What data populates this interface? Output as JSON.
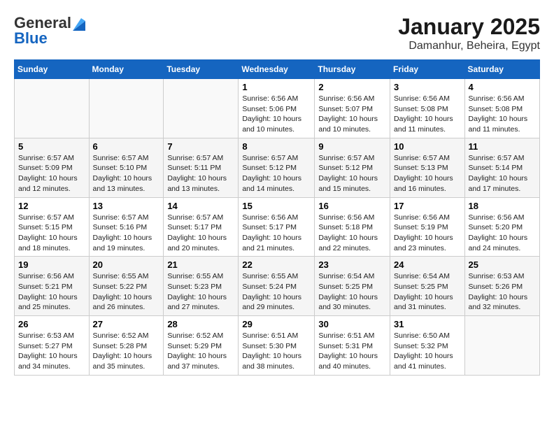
{
  "logo": {
    "general": "General",
    "blue": "Blue"
  },
  "title": {
    "month": "January 2025",
    "location": "Damanhur, Beheira, Egypt"
  },
  "weekdays": [
    "Sunday",
    "Monday",
    "Tuesday",
    "Wednesday",
    "Thursday",
    "Friday",
    "Saturday"
  ],
  "weeks": [
    [
      {
        "day": "",
        "info": ""
      },
      {
        "day": "",
        "info": ""
      },
      {
        "day": "",
        "info": ""
      },
      {
        "day": "1",
        "info": "Sunrise: 6:56 AM\nSunset: 5:06 PM\nDaylight: 10 hours\nand 10 minutes."
      },
      {
        "day": "2",
        "info": "Sunrise: 6:56 AM\nSunset: 5:07 PM\nDaylight: 10 hours\nand 10 minutes."
      },
      {
        "day": "3",
        "info": "Sunrise: 6:56 AM\nSunset: 5:08 PM\nDaylight: 10 hours\nand 11 minutes."
      },
      {
        "day": "4",
        "info": "Sunrise: 6:56 AM\nSunset: 5:08 PM\nDaylight: 10 hours\nand 11 minutes."
      }
    ],
    [
      {
        "day": "5",
        "info": "Sunrise: 6:57 AM\nSunset: 5:09 PM\nDaylight: 10 hours\nand 12 minutes."
      },
      {
        "day": "6",
        "info": "Sunrise: 6:57 AM\nSunset: 5:10 PM\nDaylight: 10 hours\nand 13 minutes."
      },
      {
        "day": "7",
        "info": "Sunrise: 6:57 AM\nSunset: 5:11 PM\nDaylight: 10 hours\nand 13 minutes."
      },
      {
        "day": "8",
        "info": "Sunrise: 6:57 AM\nSunset: 5:12 PM\nDaylight: 10 hours\nand 14 minutes."
      },
      {
        "day": "9",
        "info": "Sunrise: 6:57 AM\nSunset: 5:12 PM\nDaylight: 10 hours\nand 15 minutes."
      },
      {
        "day": "10",
        "info": "Sunrise: 6:57 AM\nSunset: 5:13 PM\nDaylight: 10 hours\nand 16 minutes."
      },
      {
        "day": "11",
        "info": "Sunrise: 6:57 AM\nSunset: 5:14 PM\nDaylight: 10 hours\nand 17 minutes."
      }
    ],
    [
      {
        "day": "12",
        "info": "Sunrise: 6:57 AM\nSunset: 5:15 PM\nDaylight: 10 hours\nand 18 minutes."
      },
      {
        "day": "13",
        "info": "Sunrise: 6:57 AM\nSunset: 5:16 PM\nDaylight: 10 hours\nand 19 minutes."
      },
      {
        "day": "14",
        "info": "Sunrise: 6:57 AM\nSunset: 5:17 PM\nDaylight: 10 hours\nand 20 minutes."
      },
      {
        "day": "15",
        "info": "Sunrise: 6:56 AM\nSunset: 5:17 PM\nDaylight: 10 hours\nand 21 minutes."
      },
      {
        "day": "16",
        "info": "Sunrise: 6:56 AM\nSunset: 5:18 PM\nDaylight: 10 hours\nand 22 minutes."
      },
      {
        "day": "17",
        "info": "Sunrise: 6:56 AM\nSunset: 5:19 PM\nDaylight: 10 hours\nand 23 minutes."
      },
      {
        "day": "18",
        "info": "Sunrise: 6:56 AM\nSunset: 5:20 PM\nDaylight: 10 hours\nand 24 minutes."
      }
    ],
    [
      {
        "day": "19",
        "info": "Sunrise: 6:56 AM\nSunset: 5:21 PM\nDaylight: 10 hours\nand 25 minutes."
      },
      {
        "day": "20",
        "info": "Sunrise: 6:55 AM\nSunset: 5:22 PM\nDaylight: 10 hours\nand 26 minutes."
      },
      {
        "day": "21",
        "info": "Sunrise: 6:55 AM\nSunset: 5:23 PM\nDaylight: 10 hours\nand 27 minutes."
      },
      {
        "day": "22",
        "info": "Sunrise: 6:55 AM\nSunset: 5:24 PM\nDaylight: 10 hours\nand 29 minutes."
      },
      {
        "day": "23",
        "info": "Sunrise: 6:54 AM\nSunset: 5:25 PM\nDaylight: 10 hours\nand 30 minutes."
      },
      {
        "day": "24",
        "info": "Sunrise: 6:54 AM\nSunset: 5:25 PM\nDaylight: 10 hours\nand 31 minutes."
      },
      {
        "day": "25",
        "info": "Sunrise: 6:53 AM\nSunset: 5:26 PM\nDaylight: 10 hours\nand 32 minutes."
      }
    ],
    [
      {
        "day": "26",
        "info": "Sunrise: 6:53 AM\nSunset: 5:27 PM\nDaylight: 10 hours\nand 34 minutes."
      },
      {
        "day": "27",
        "info": "Sunrise: 6:52 AM\nSunset: 5:28 PM\nDaylight: 10 hours\nand 35 minutes."
      },
      {
        "day": "28",
        "info": "Sunrise: 6:52 AM\nSunset: 5:29 PM\nDaylight: 10 hours\nand 37 minutes."
      },
      {
        "day": "29",
        "info": "Sunrise: 6:51 AM\nSunset: 5:30 PM\nDaylight: 10 hours\nand 38 minutes."
      },
      {
        "day": "30",
        "info": "Sunrise: 6:51 AM\nSunset: 5:31 PM\nDaylight: 10 hours\nand 40 minutes."
      },
      {
        "day": "31",
        "info": "Sunrise: 6:50 AM\nSunset: 5:32 PM\nDaylight: 10 hours\nand 41 minutes."
      },
      {
        "day": "",
        "info": ""
      }
    ]
  ]
}
